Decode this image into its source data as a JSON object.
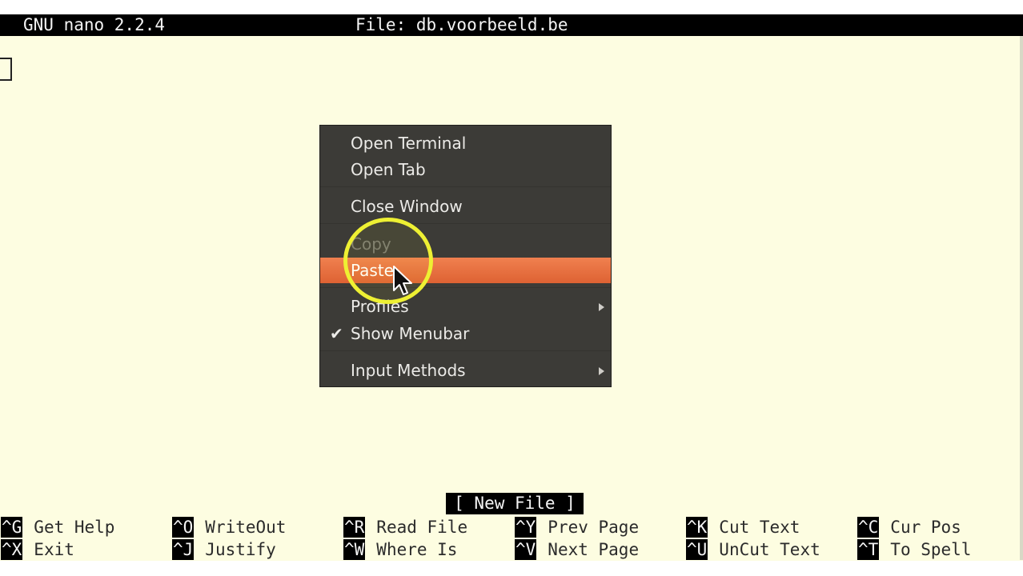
{
  "nano": {
    "version": "GNU nano 2.2.4",
    "file_label": "File: db.voorbeeld.be",
    "status": "[ New File ]"
  },
  "context_menu": {
    "items": [
      {
        "label": "Open Terminal",
        "state": "normal"
      },
      {
        "label": "Open Tab",
        "state": "normal"
      },
      {
        "label": "Close Window",
        "state": "normal"
      },
      {
        "label": "Copy",
        "state": "disabled"
      },
      {
        "label": "Paste",
        "state": "highlighted"
      },
      {
        "label": "Profiles",
        "state": "submenu"
      },
      {
        "label": "Show Menubar",
        "state": "checked"
      },
      {
        "label": "Input Methods",
        "state": "submenu"
      }
    ],
    "check_glyph": "✔"
  },
  "shortcuts": [
    {
      "key": "^G",
      "label": "Get Help"
    },
    {
      "key": "^O",
      "label": "WriteOut"
    },
    {
      "key": "^R",
      "label": "Read File"
    },
    {
      "key": "^Y",
      "label": "Prev Page"
    },
    {
      "key": "^K",
      "label": "Cut Text"
    },
    {
      "key": "^C",
      "label": "Cur Pos"
    },
    {
      "key": "^X",
      "label": "Exit"
    },
    {
      "key": "^J",
      "label": "Justify"
    },
    {
      "key": "^W",
      "label": "Where Is"
    },
    {
      "key": "^V",
      "label": "Next Page"
    },
    {
      "key": "^U",
      "label": "UnCut Text"
    },
    {
      "key": "^T",
      "label": "To Spell"
    }
  ],
  "colors": {
    "editor_bg": "#fdfde1",
    "menu_bg": "#3c3b37",
    "menu_highlight": "#e9703f",
    "ring": "#eef033"
  }
}
